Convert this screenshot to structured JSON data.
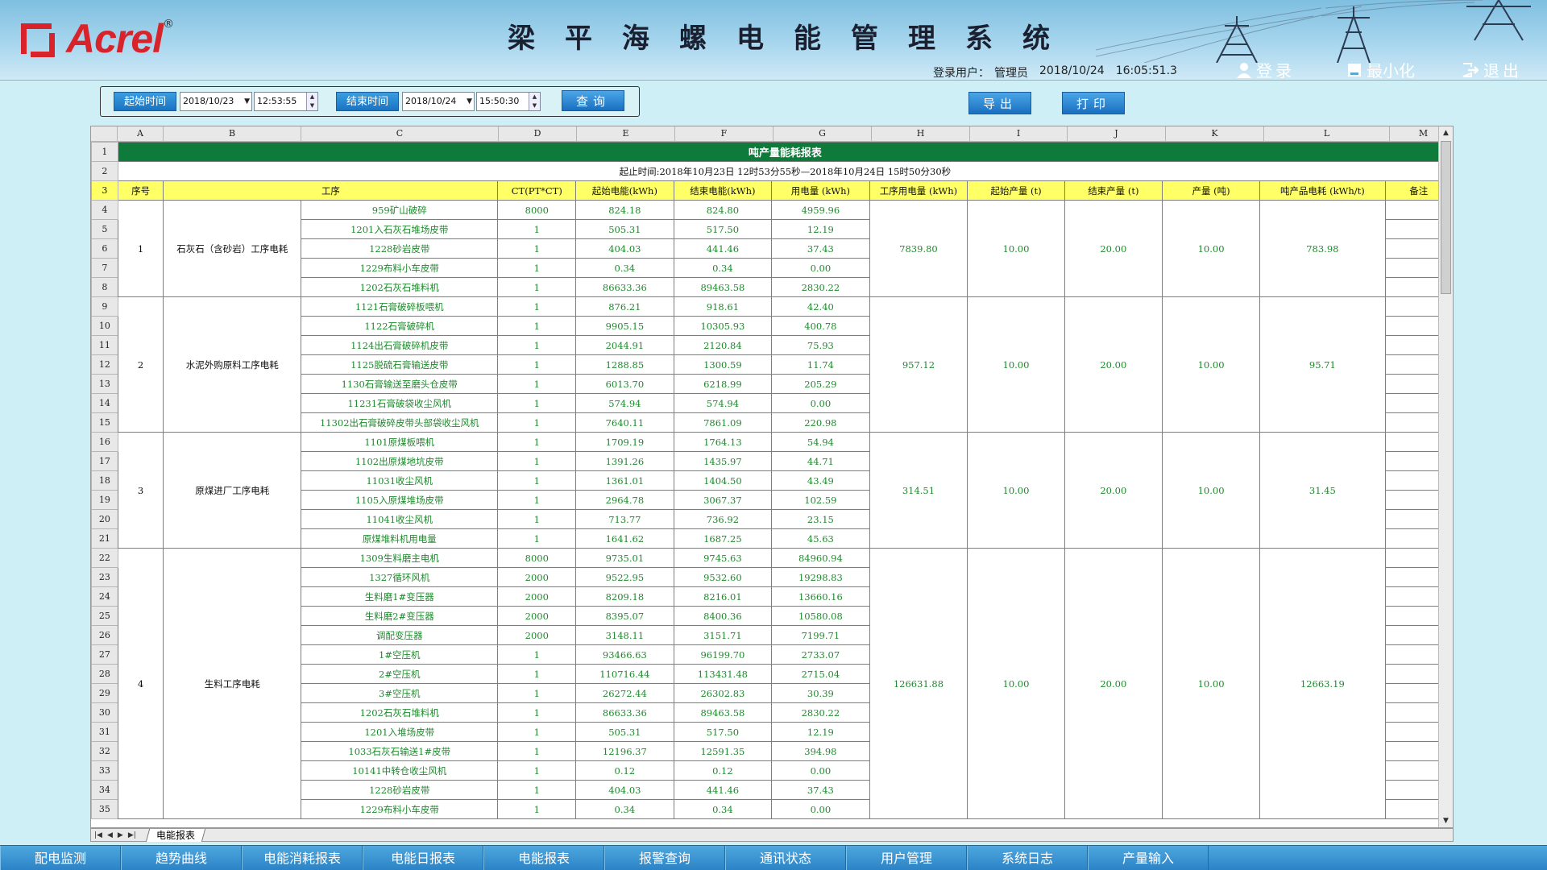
{
  "app": {
    "logo": "Acrel",
    "logo_reg": "®",
    "title": "梁平海螺电能管理系统"
  },
  "login": {
    "user_label": "登录用户：",
    "user": "管理员",
    "date": "2018/10/24",
    "time": "16:05:51.3"
  },
  "header_buttons": {
    "login": "登录",
    "minimize": "最小化",
    "exit": "退出"
  },
  "toolbar": {
    "start_label": "起始时间",
    "start_date": "2018/10/23",
    "start_time": "12:53:55",
    "end_label": "结束时间",
    "end_date": "2018/10/24",
    "end_time": "15:50:30",
    "query": "查询"
  },
  "actions": {
    "export": "导出",
    "print": "打印"
  },
  "columns": [
    "A",
    "B",
    "C",
    "D",
    "E",
    "F",
    "G",
    "H",
    "I",
    "J",
    "K",
    "L",
    "M"
  ],
  "report": {
    "title": "吨产量能耗报表",
    "range": "起止时间:2018年10月23日 12时53分55秒—2018年10月24日 15时50分30秒",
    "headers": [
      "序号",
      "工序",
      "CT(PT*CT)",
      "起始电能(kWh)",
      "结束电能(kWh)",
      "用电量 (kWh)",
      "工序用电量 (kWh)",
      "起始产量 (t)",
      "结束产量 (t)",
      "产量 (吨)",
      "吨产品电耗 (kWh/t)",
      "备注"
    ],
    "groups": [
      {
        "no": "1",
        "name": "石灰石（含砂岩）工序电耗",
        "process_kwh": "7839.80",
        "start_t": "10.00",
        "end_t": "20.00",
        "output": "10.00",
        "per_ton": "783.98",
        "rows": [
          [
            "959矿山破碎",
            "8000",
            "824.18",
            "824.80",
            "4959.96"
          ],
          [
            "1201入石灰石堆场皮带",
            "1",
            "505.31",
            "517.50",
            "12.19"
          ],
          [
            "1228砂岩皮带",
            "1",
            "404.03",
            "441.46",
            "37.43"
          ],
          [
            "1229布料小车皮带",
            "1",
            "0.34",
            "0.34",
            "0.00"
          ],
          [
            "1202石灰石堆料机",
            "1",
            "86633.36",
            "89463.58",
            "2830.22"
          ]
        ]
      },
      {
        "no": "2",
        "name": "水泥外购原料工序电耗",
        "process_kwh": "957.12",
        "start_t": "10.00",
        "end_t": "20.00",
        "output": "10.00",
        "per_ton": "95.71",
        "rows": [
          [
            "1121石膏破碎板喂机",
            "1",
            "876.21",
            "918.61",
            "42.40"
          ],
          [
            "1122石膏破碎机",
            "1",
            "9905.15",
            "10305.93",
            "400.78"
          ],
          [
            "1124出石膏破碎机皮带",
            "1",
            "2044.91",
            "2120.84",
            "75.93"
          ],
          [
            "1125脱硫石膏输送皮带",
            "1",
            "1288.85",
            "1300.59",
            "11.74"
          ],
          [
            "1130石膏输送至磨头仓皮带",
            "1",
            "6013.70",
            "6218.99",
            "205.29"
          ],
          [
            "11231石膏破袋收尘风机",
            "1",
            "574.94",
            "574.94",
            "0.00"
          ],
          [
            "11302出石膏破碎皮带头部袋收尘风机",
            "1",
            "7640.11",
            "7861.09",
            "220.98"
          ]
        ]
      },
      {
        "no": "3",
        "name": "原煤进厂工序电耗",
        "process_kwh": "314.51",
        "start_t": "10.00",
        "end_t": "20.00",
        "output": "10.00",
        "per_ton": "31.45",
        "rows": [
          [
            "1101原煤板喂机",
            "1",
            "1709.19",
            "1764.13",
            "54.94"
          ],
          [
            "1102出原煤地坑皮带",
            "1",
            "1391.26",
            "1435.97",
            "44.71"
          ],
          [
            "11031收尘风机",
            "1",
            "1361.01",
            "1404.50",
            "43.49"
          ],
          [
            "1105入原煤堆场皮带",
            "1",
            "2964.78",
            "3067.37",
            "102.59"
          ],
          [
            "11041收尘风机",
            "1",
            "713.77",
            "736.92",
            "23.15"
          ],
          [
            "原煤堆料机用电量",
            "1",
            "1641.62",
            "1687.25",
            "45.63"
          ]
        ]
      },
      {
        "no": "4",
        "name": "生料工序电耗",
        "process_kwh": "126631.88",
        "start_t": "10.00",
        "end_t": "20.00",
        "output": "10.00",
        "per_ton": "12663.19",
        "rows": [
          [
            "1309生料磨主电机",
            "8000",
            "9735.01",
            "9745.63",
            "84960.94"
          ],
          [
            "1327循环风机",
            "2000",
            "9522.95",
            "9532.60",
            "19298.83"
          ],
          [
            "生料磨1#变压器",
            "2000",
            "8209.18",
            "8216.01",
            "13660.16"
          ],
          [
            "生料磨2#变压器",
            "2000",
            "8395.07",
            "8400.36",
            "10580.08"
          ],
          [
            "调配变压器",
            "2000",
            "3148.11",
            "3151.71",
            "7199.71"
          ],
          [
            "1#空压机",
            "1",
            "93466.63",
            "96199.70",
            "2733.07"
          ],
          [
            "2#空压机",
            "1",
            "110716.44",
            "113431.48",
            "2715.04"
          ],
          [
            "3#空压机",
            "1",
            "26272.44",
            "26302.83",
            "30.39"
          ],
          [
            "1202石灰石堆料机",
            "1",
            "86633.36",
            "89463.58",
            "2830.22"
          ],
          [
            "1201入堆场皮带",
            "1",
            "505.31",
            "517.50",
            "12.19"
          ],
          [
            "1033石灰石输送1#皮带",
            "1",
            "12196.37",
            "12591.35",
            "394.98"
          ],
          [
            "10141中转仓收尘风机",
            "1",
            "0.12",
            "0.12",
            "0.00"
          ],
          [
            "1228砂岩皮带",
            "1",
            "404.03",
            "441.46",
            "37.43"
          ],
          [
            "1229布料小车皮带",
            "1",
            "0.34",
            "0.34",
            "0.00"
          ]
        ]
      }
    ]
  },
  "sheet_tab": "电能报表",
  "bottom_nav": [
    "配电监测",
    "趋势曲线",
    "电能消耗报表",
    "电能日报表",
    "电能报表",
    "报警查询",
    "通讯状态",
    "用户管理",
    "系统日志",
    "产量输入"
  ]
}
